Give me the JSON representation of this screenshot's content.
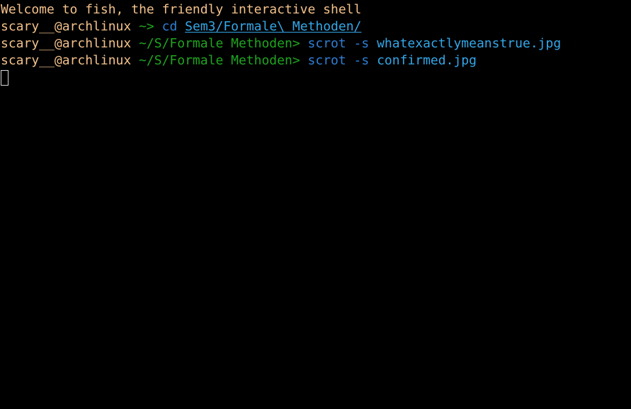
{
  "terminal": {
    "welcome": "Welcome to fish, the friendly interactive shell",
    "lines": [
      {
        "user": "scary__@archlinux",
        "cwd": "~",
        "prompt_char": ">",
        "command": "cd",
        "option": "",
        "argument": "Sem3/Formale\\ Methoden/"
      },
      {
        "user": "scary__@archlinux",
        "cwd": "~/S/Formale Methoden",
        "prompt_char": ">",
        "command": "scrot",
        "option": "-s",
        "argument": "whatexactlymeanstrue.jpg"
      },
      {
        "user": "scary__@archlinux",
        "cwd": "~/S/Formale Methoden",
        "prompt_char": ">",
        "command": "scrot",
        "option": "-s",
        "argument": "confirmed.jpg"
      }
    ]
  },
  "colors": {
    "background": "#000000",
    "user": "#f2c18b",
    "cwd": "#1fa51f",
    "command": "#2f7fd6",
    "argument": "#34a7e8",
    "cursor": "#d8d8d8"
  }
}
